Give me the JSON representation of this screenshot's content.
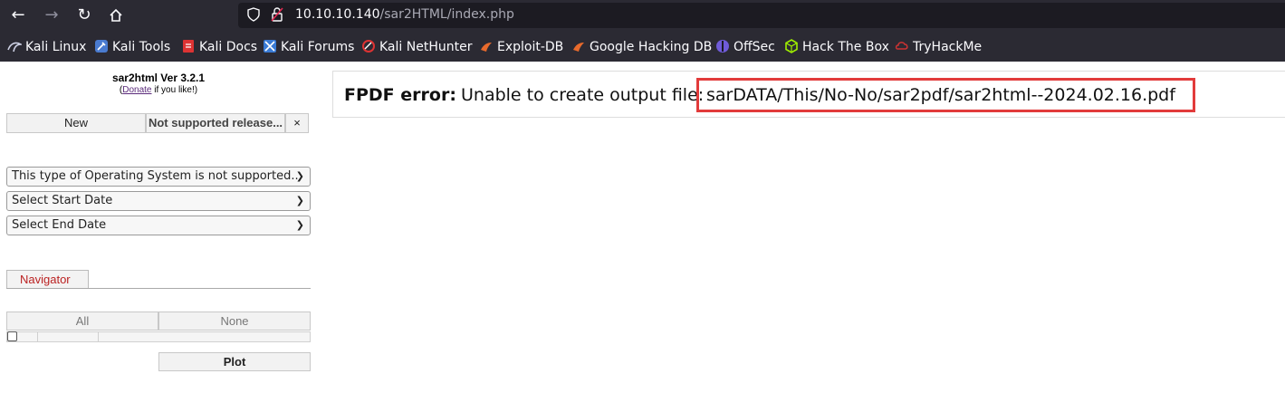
{
  "browser": {
    "url_host": "10.10.10.140",
    "url_path": "/sar2HTML/index.php"
  },
  "bookmarks": [
    {
      "label": "Kali Linux",
      "icon": "kali-dragon-icon",
      "color": "#cfd2e6"
    },
    {
      "label": "Kali Tools",
      "icon": "kali-tools-icon",
      "color": "#4a7bd0"
    },
    {
      "label": "Kali Docs",
      "icon": "kali-docs-icon",
      "color": "#d33"
    },
    {
      "label": "Kali Forums",
      "icon": "kali-forums-icon",
      "color": "#3a7bd5"
    },
    {
      "label": "Kali NetHunter",
      "icon": "nethunter-icon",
      "color": "#d33"
    },
    {
      "label": "Exploit-DB",
      "icon": "exploit-db-icon",
      "color": "#e86a2c"
    },
    {
      "label": "Google Hacking DB",
      "icon": "ghdb-icon",
      "color": "#e86a2c"
    },
    {
      "label": "OffSec",
      "icon": "offsec-icon",
      "color": "#6f5bd8"
    },
    {
      "label": "Hack The Box",
      "icon": "htb-icon",
      "color": "#9fef00"
    },
    {
      "label": "TryHackMe",
      "icon": "tryhackme-icon",
      "color": "#c33"
    }
  ],
  "app": {
    "title": "sar2html Ver 3.2.1",
    "donate_prefix": "(",
    "donate_link": "Donate",
    "donate_suffix": " if you like!)"
  },
  "buttons": {
    "new": "New",
    "release": "Not supported release...",
    "close": "×",
    "all": "All",
    "none": "None",
    "plot": "Plot"
  },
  "selects": {
    "os": "This type of Operating System is not supported..",
    "start_date": "Select Start Date",
    "end_date": "Select End Date"
  },
  "navigator_tab": "Navigator",
  "error": {
    "label": "FPDF error:",
    "message": "Unable to create output file:",
    "file": "sarDATA/This/No-No/sar2pdf/sar2html--2024.02.16.pdf",
    "highlight_color": "#e23b3b"
  }
}
